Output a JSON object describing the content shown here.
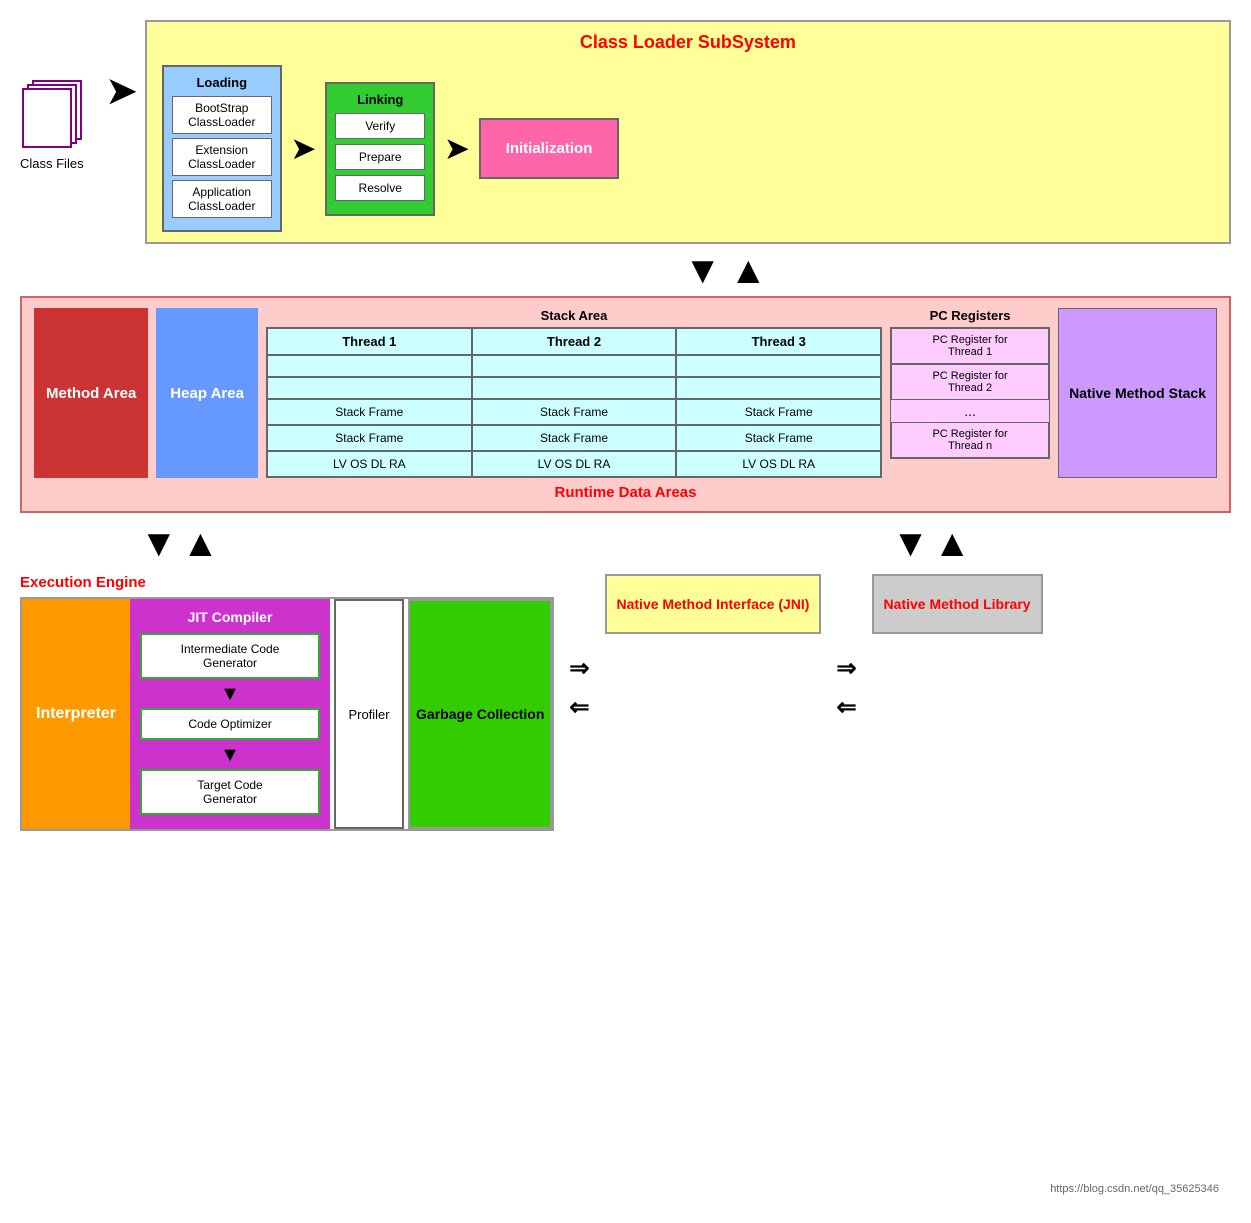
{
  "classLoader": {
    "title": "Class Loader SubSystem",
    "classFilesLabel": "Class Files",
    "loading": {
      "title": "Loading",
      "items": [
        "BootStrap ClassLoader",
        "Extension ClassLoader",
        "Application ClassLoader"
      ]
    },
    "linking": {
      "title": "Linking",
      "items": [
        "Verify",
        "Prepare",
        "Resolve"
      ]
    },
    "initialization": "Initialization"
  },
  "runtime": {
    "title": "Runtime Data Areas",
    "methodArea": "Method Area",
    "heapArea": "Heap Area",
    "stackArea": {
      "label": "Stack Area",
      "headers": [
        "Thread 1",
        "Thread 2",
        "Thread 3"
      ],
      "rows": [
        [
          "",
          "",
          ""
        ],
        [
          "",
          "",
          ""
        ],
        [
          "Stack Frame",
          "Stack Frame",
          "Stack Frame"
        ],
        [
          "Stack Frame",
          "Stack Frame",
          "Stack Frame"
        ],
        [
          "LV OS DL RA",
          "LV OS DL RA",
          "LV OS DL RA"
        ]
      ]
    },
    "pcRegisters": {
      "label": "PC Registers",
      "items": [
        "PC Register for Thread 1",
        "PC Register for Thread 2",
        "...",
        "PC Register for Thread n"
      ]
    },
    "nativeMethodStack": "Native Method Stack"
  },
  "executionEngine": {
    "label": "Execution Engine",
    "interpreter": "Interpreter",
    "jitCompiler": {
      "title": "JIT Compiler",
      "steps": [
        "Intermediate Code Generator",
        "Code Optimizer",
        "Target Code Generator"
      ]
    },
    "profiler": "Profiler",
    "garbageCollection": "Garbage Collection"
  },
  "nativeInterface": {
    "title": "Native Method Interface (JNI)",
    "library": "Native Method Library"
  },
  "watermark": "https://blog.csdn.net/qq_35625346"
}
